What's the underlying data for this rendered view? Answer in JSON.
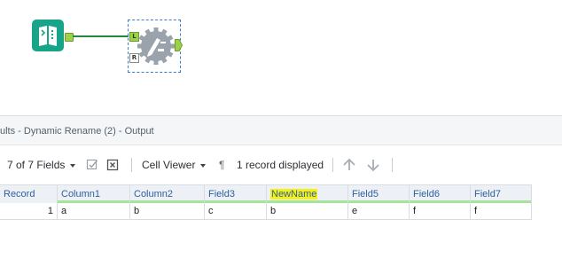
{
  "canvas": {
    "anchor_left_label": "L",
    "anchor_right_label": "R"
  },
  "results": {
    "title_prefix": "ults",
    "title_rest": " - Dynamic Rename (2) - Output"
  },
  "toolbar": {
    "fields_label": "7 of 7 Fields",
    "viewer_label": "Cell Viewer",
    "pilcrow": "¶",
    "record_count_label": "1 record displayed"
  },
  "grid": {
    "columns": [
      "Record",
      "Column1",
      "Column2",
      "Field3",
      "NewName",
      "Field5",
      "Field6",
      "Field7"
    ],
    "highlighted_column": "NewName",
    "rows": [
      [
        "1",
        "a",
        "b",
        "c",
        "b",
        "e",
        "f",
        "f"
      ]
    ]
  },
  "colors": {
    "tool_teal": "#18a489",
    "anchor_green": "#9ed14a",
    "connector_green": "#1f8a3c",
    "header_blue_text": "#2e5f9e",
    "highlight_yellow": "#f4f01a",
    "field_underline": "#a5e59a"
  }
}
